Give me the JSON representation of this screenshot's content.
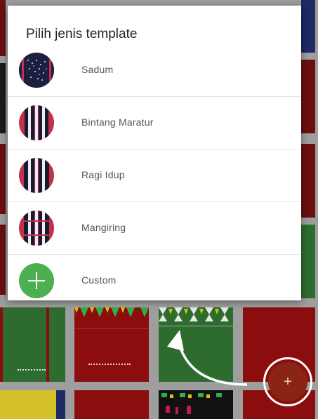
{
  "dialog": {
    "title": "Pilih jenis template",
    "options": [
      {
        "label": "Sadum",
        "thumb": "ulos-sadum-thumbnail",
        "style": "dark"
      },
      {
        "label": "Bintang Maratur",
        "thumb": "ulos-bintang-maratur-thumbnail",
        "style": "striped"
      },
      {
        "label": "Ragi Idup",
        "thumb": "ulos-ragi-idup-thumbnail",
        "style": "striped"
      },
      {
        "label": "Mangiring",
        "thumb": "ulos-mangiring-thumbnail",
        "style": "striped"
      },
      {
        "label": "Custom",
        "thumb": "plus-icon",
        "style": "add"
      }
    ]
  },
  "fab": {
    "icon": "plus-icon",
    "label": "+"
  },
  "colors": {
    "dim_overlay": "#9e9e9e",
    "ulos_red": "#8b0d0d",
    "ulos_green": "#2e6b2e",
    "ulos_yellow": "#d4c02a",
    "ulos_navy": "#1d2a63",
    "custom_green": "#4caf50",
    "fab_red": "#8a2415"
  }
}
